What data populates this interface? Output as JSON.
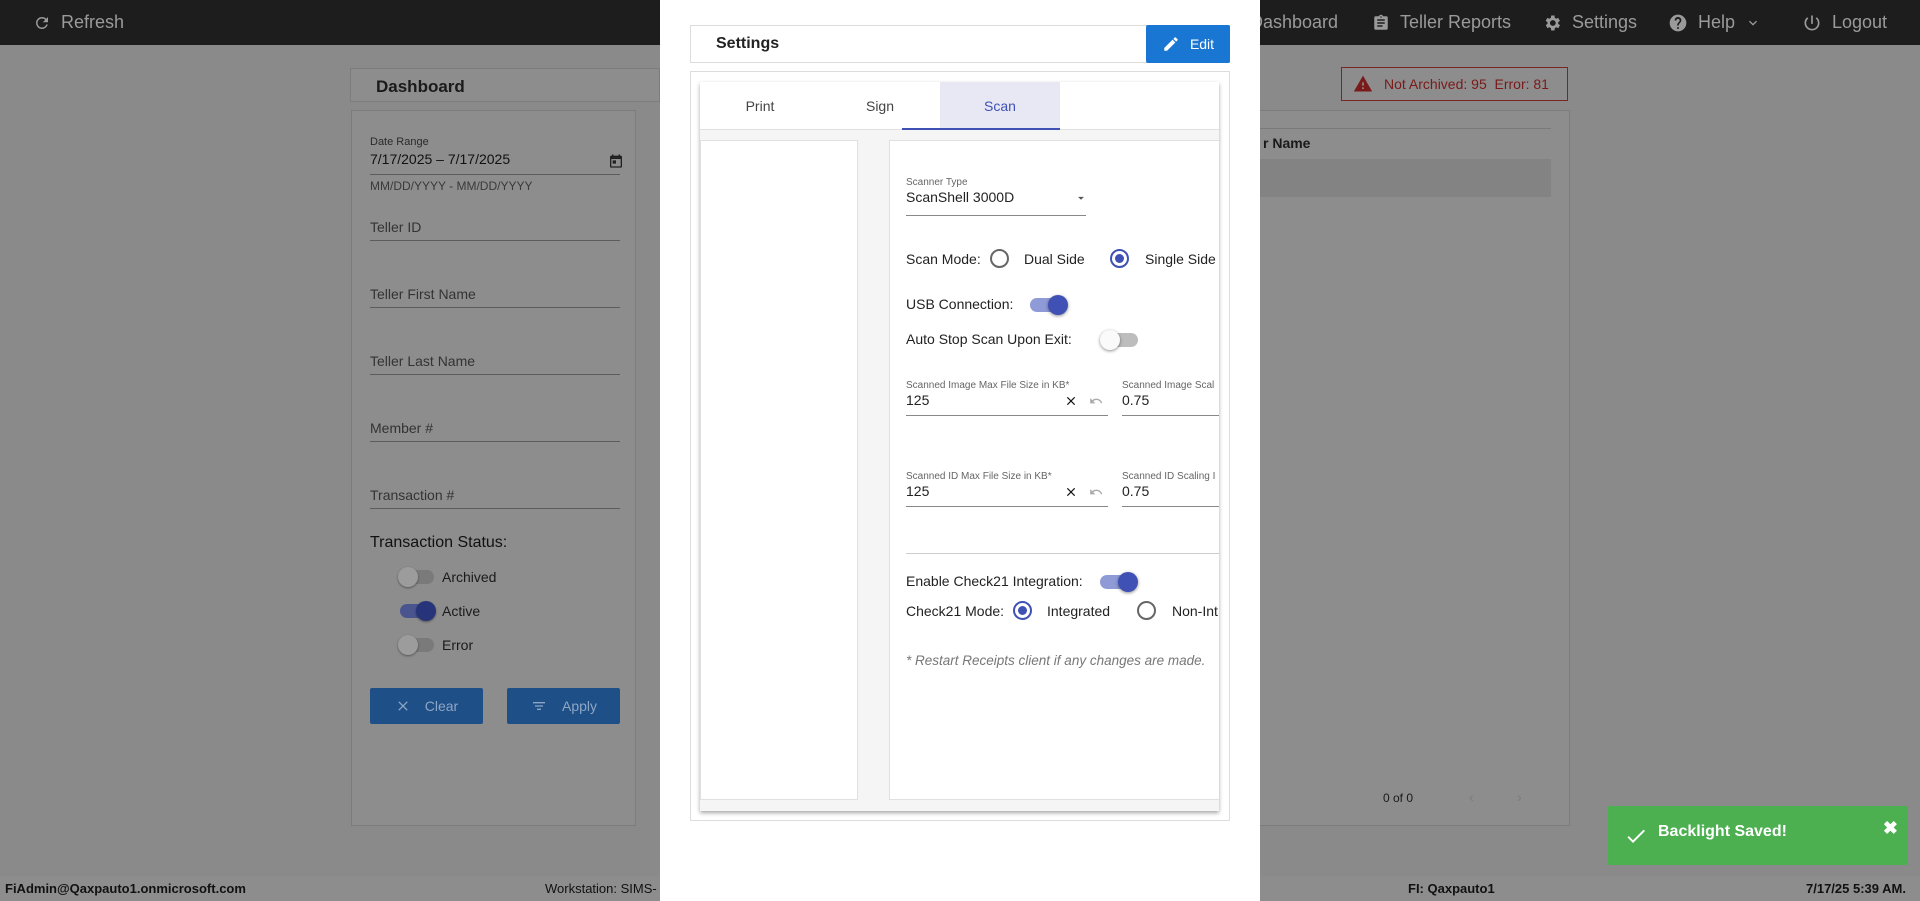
{
  "topbar": {
    "refresh": "Refresh",
    "dashboard": "Dashboard",
    "teller_reports": "Teller Reports",
    "settings": "Settings",
    "help": "Help",
    "logout": "Logout"
  },
  "dashboard": {
    "title": "Dashboard",
    "date_range_label": "Date Range",
    "date_range_value": "7/17/2025 – 7/17/2025",
    "date_hint": "MM/DD/YYYY - MM/DD/YYYY",
    "teller_id": "Teller ID",
    "teller_first": "Teller First Name",
    "teller_last": "Teller Last Name",
    "member": "Member #",
    "transaction": "Transaction #",
    "status_heading": "Transaction Status:",
    "statuses": [
      {
        "label": "Archived",
        "on": false
      },
      {
        "label": "Active",
        "on": true
      },
      {
        "label": "Error",
        "on": false
      }
    ],
    "clear": "Clear",
    "apply": "Apply"
  },
  "alert": {
    "text": "Not Archived: 95  Error: 81"
  },
  "results": {
    "col_header": "r Name",
    "pagination": "0 of 0"
  },
  "footer": {
    "user": "FiAdmin@Qaxpauto1.onmicrosoft.com",
    "workstation": "Workstation: SIMS-",
    "fi": "FI: Qaxpauto1",
    "datetime": "7/17/25 5:39 AM."
  },
  "modal": {
    "title": "Settings",
    "edit": "Edit",
    "tabs": [
      "Print",
      "Sign",
      "Scan"
    ],
    "active_tab": "Scan",
    "scanner_type_label": "Scanner Type",
    "scanner_type_value": "ScanShell 3000D",
    "scan_mode_label": "Scan Mode:",
    "scan_mode_options": [
      "Dual Side",
      "Single Side"
    ],
    "scan_mode_selected": "Single Side",
    "usb_label": "USB Connection:",
    "usb_on": true,
    "auto_stop_label": "Auto Stop Scan Upon Exit:",
    "auto_stop_on": false,
    "img_max_label": "Scanned Image Max File Size in KB*",
    "img_max_value": "125",
    "img_scale_label": "Scanned Image Scal",
    "img_scale_value": "0.75",
    "id_max_label": "Scanned ID Max File Size in KB*",
    "id_max_value": "125",
    "id_scale_label": "Scanned ID Scaling I",
    "id_scale_value": "0.75",
    "check21_label": "Enable Check21 Integration:",
    "check21_on": true,
    "check21_mode_label": "Check21 Mode:",
    "check21_options": [
      "Integrated",
      "Non-Int"
    ],
    "check21_selected": "Integrated",
    "note": "* Restart Receipts client if any changes are made."
  },
  "toast": {
    "message": "Backlight Saved!",
    "color": "#4caf50"
  }
}
